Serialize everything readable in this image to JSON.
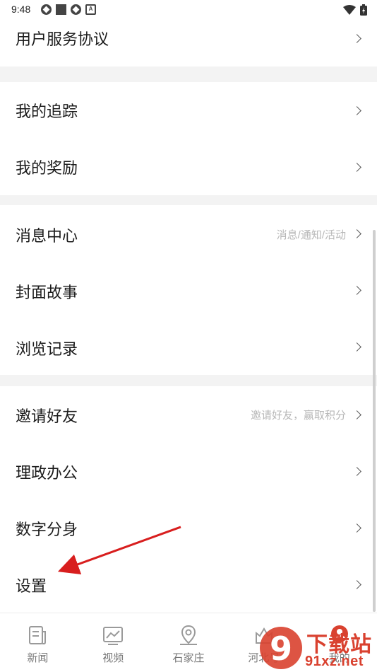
{
  "status_bar": {
    "time": "9:48"
  },
  "menu": {
    "user_agreement": "用户服务协议",
    "my_tracking": "我的追踪",
    "my_rewards": "我的奖励",
    "message_center": "消息中心",
    "message_center_hint": "消息/通知/活动",
    "cover_story": "封面故事",
    "browse_history": "浏览记录",
    "invite_friends": "邀请好友",
    "invite_friends_hint": "邀请好友，赢取积分",
    "government_office": "理政办公",
    "digital_avatar": "数字分身",
    "settings": "设置"
  },
  "tabs": [
    {
      "label": "新闻",
      "icon": "news-icon"
    },
    {
      "label": "视频",
      "icon": "video-icon"
    },
    {
      "label": "石家庄",
      "icon": "location-icon"
    },
    {
      "label": "河北号",
      "icon": "hebei-icon"
    },
    {
      "label": "我的",
      "icon": "profile-icon"
    }
  ],
  "watermark": {
    "line1": "下载站",
    "line2": "91xz.net",
    "logo": "9"
  },
  "colors": {
    "arrow": "#d81e1e",
    "watermark": "#d9412f",
    "separator": "#f3f3f3"
  }
}
